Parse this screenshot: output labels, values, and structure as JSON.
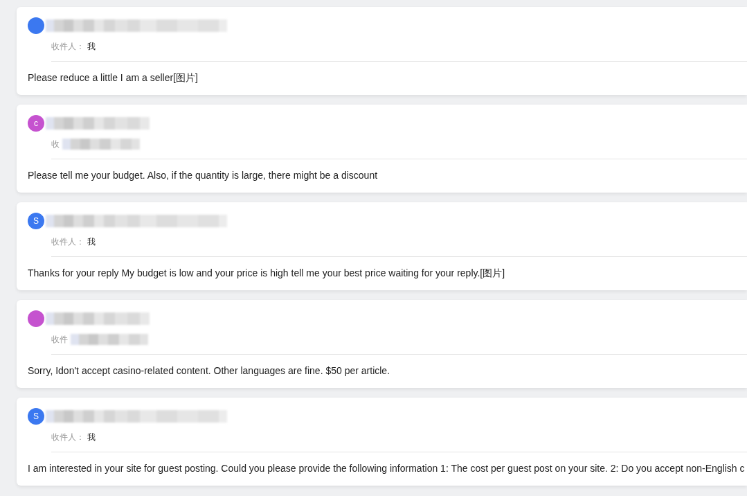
{
  "cards": [
    {
      "color": "#3b78f0",
      "sender_redacted": true,
      "sender_redaction_long": true,
      "recipient_label": "收件人：",
      "recipient": "我",
      "recipient_redacted": false,
      "body": "Please reduce a little I am a seller[图片]"
    },
    {
      "avatar_letter": "c",
      "color": "#c552cf",
      "sender_redacted": true,
      "sender_redaction_long": false,
      "recipient_label": "收",
      "recipient_redacted": true,
      "body": "Please tell me your budget. Also, if the quantity is large, there might be a discount"
    },
    {
      "avatar_letter": "S",
      "color": "#3b78f0",
      "sender_redacted": true,
      "sender_redaction_long": true,
      "recipient_label": "收件人：",
      "recipient": "我",
      "recipient_redacted": false,
      "body": "Thanks for your reply My budget is low and your price is high tell me your best price waiting for your reply.[图片]"
    },
    {
      "color": "#c552cf",
      "sender_redacted": true,
      "sender_redaction_long": false,
      "recipient_label": "收件",
      "recipient_redacted": true,
      "body": "Sorry, Idon't accept casino-related content. Other languages are fine. $50 per article."
    },
    {
      "avatar_letter": "S",
      "color": "#3b78f0",
      "sender_redacted": true,
      "sender_redaction_long": true,
      "recipient_label": "收件人：",
      "recipient": "我",
      "recipient_redacted": false,
      "body": "I am interested in your site for guest posting. Could you please provide the following information 1: The cost per guest post on your site. 2: Do you accept non-English c"
    }
  ]
}
